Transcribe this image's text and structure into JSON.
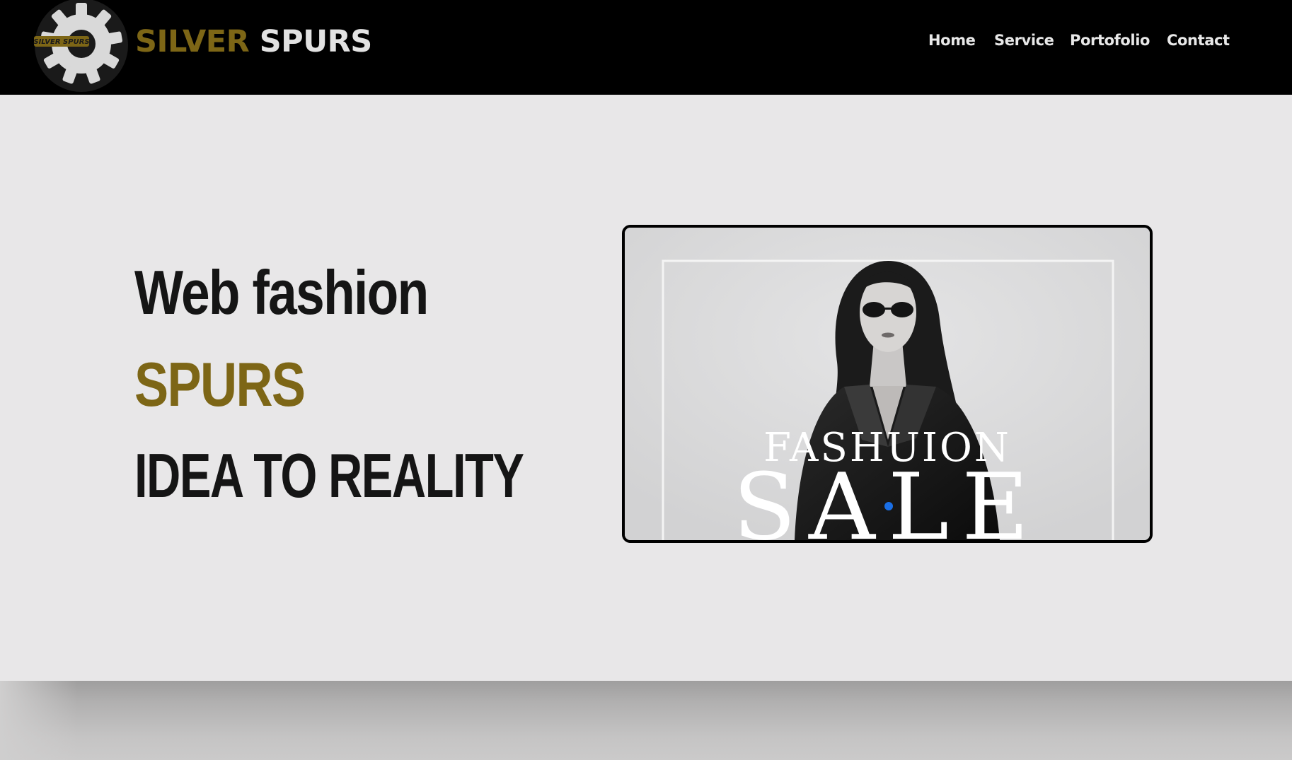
{
  "header": {
    "logo": {
      "icon": "gear-logo-icon",
      "badge_text": "SILVER SPURS"
    },
    "brand": {
      "part1": "SILVER",
      "part2": "SPURS"
    },
    "nav": [
      {
        "label": "Home"
      },
      {
        "label": "Service"
      },
      {
        "label": "Portofolio"
      },
      {
        "label": "Contact"
      }
    ]
  },
  "hero": {
    "line1": "Web fashion",
    "line2": "SPURS",
    "line3": "IDEA TO REALITY"
  },
  "carousel": {
    "slide_heading": "FASHUION",
    "slide_subheading": "SALE",
    "active_slide": 1
  },
  "colors": {
    "header_bg": "#000000",
    "accent_gold": "#7d6616",
    "page_bg": "#e8e7e8",
    "dot_active": "#1a6fe6"
  }
}
